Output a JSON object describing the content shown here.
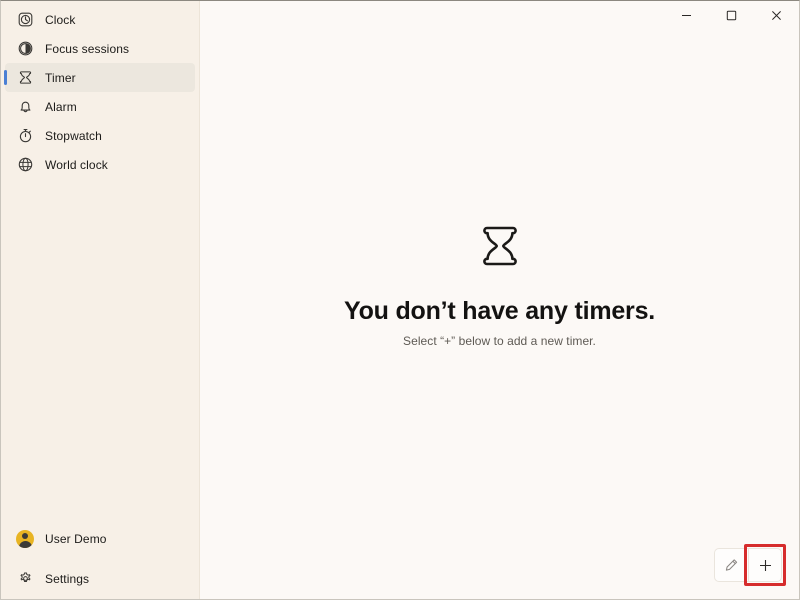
{
  "window": {
    "titlebar": {
      "minimize_label": "Minimize",
      "maximize_label": "Maximize",
      "close_label": "Close"
    }
  },
  "sidebar": {
    "items": [
      {
        "label": "Clock",
        "icon": "clock-icon",
        "selected": false
      },
      {
        "label": "Focus sessions",
        "icon": "focus-sessions-icon",
        "selected": false
      },
      {
        "label": "Timer",
        "icon": "hourglass-icon",
        "selected": true
      },
      {
        "label": "Alarm",
        "icon": "bell-icon",
        "selected": false
      },
      {
        "label": "Stopwatch",
        "icon": "stopwatch-icon",
        "selected": false
      },
      {
        "label": "World clock",
        "icon": "globe-icon",
        "selected": false
      }
    ],
    "account": {
      "label": "User Demo",
      "icon": "avatar-icon"
    },
    "settings": {
      "label": "Settings",
      "icon": "gear-icon"
    }
  },
  "main": {
    "empty_state": {
      "icon": "hourglass-icon",
      "title": "You don’t have any timers.",
      "subtitle": "Select “+” below to add a new timer."
    },
    "actions": {
      "edit_label": "Edit timers",
      "add_label": "+",
      "add_tooltip": "Add new timer"
    }
  },
  "colors": {
    "sidebar_bg": "#f7f0e7",
    "main_bg": "#fcf9f6",
    "selected_bg": "#ece7de",
    "accent_indicator": "#4a7fd4",
    "avatar_bg": "#e8b423",
    "highlight_border": "#d62c2c",
    "text_primary": "#1c1b19",
    "text_secondary": "#5e5a54"
  }
}
